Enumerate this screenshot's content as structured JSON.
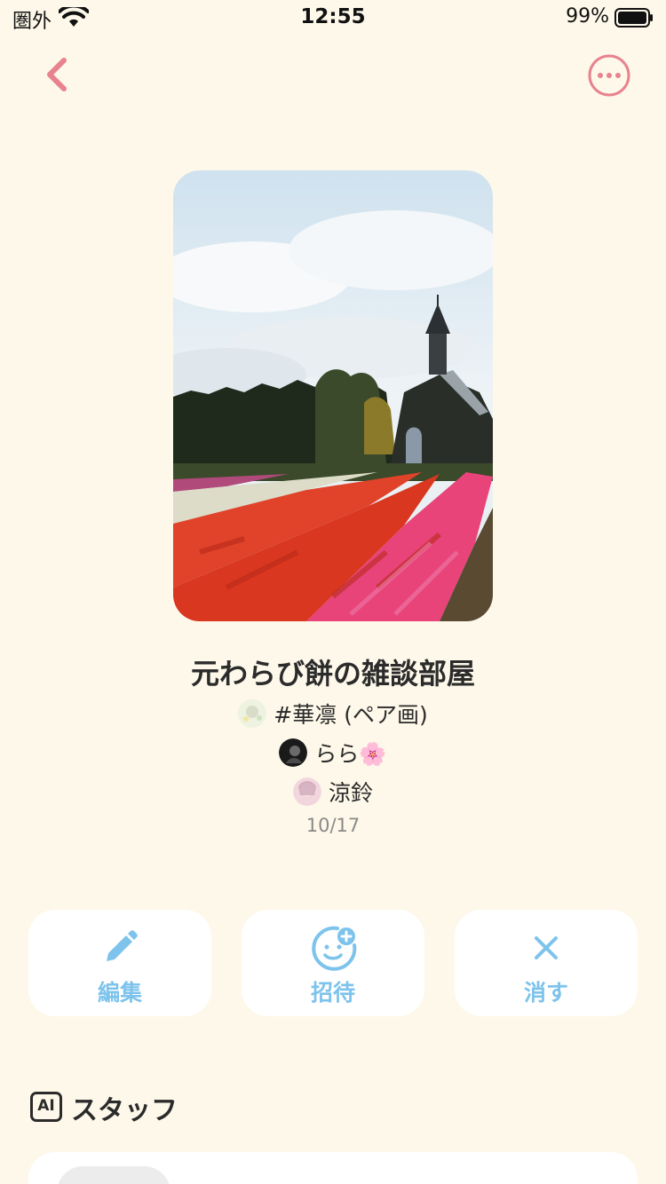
{
  "status_bar": {
    "carrier": "圏外",
    "time": "12:55",
    "battery_percent": "99%"
  },
  "nav": {
    "back_icon": "chevron-left-icon",
    "more_icon": "more-horizontal-circle-icon",
    "accent_color": "#e8828f"
  },
  "room": {
    "title": "元わらび餅の雑談部屋",
    "tag": "#華凛 (ペア画)",
    "members": [
      {
        "name": "らら🌸"
      },
      {
        "name": "涼鈴"
      }
    ],
    "date": "10/17"
  },
  "actions": [
    {
      "label": "編集",
      "icon": "pencil-icon"
    },
    {
      "label": "招待",
      "icon": "add-face-icon"
    },
    {
      "label": "消す",
      "icon": "close-icon"
    }
  ],
  "action_color": "#7dc3eb",
  "staff": {
    "badge": "AI",
    "title": "スタッフ"
  }
}
